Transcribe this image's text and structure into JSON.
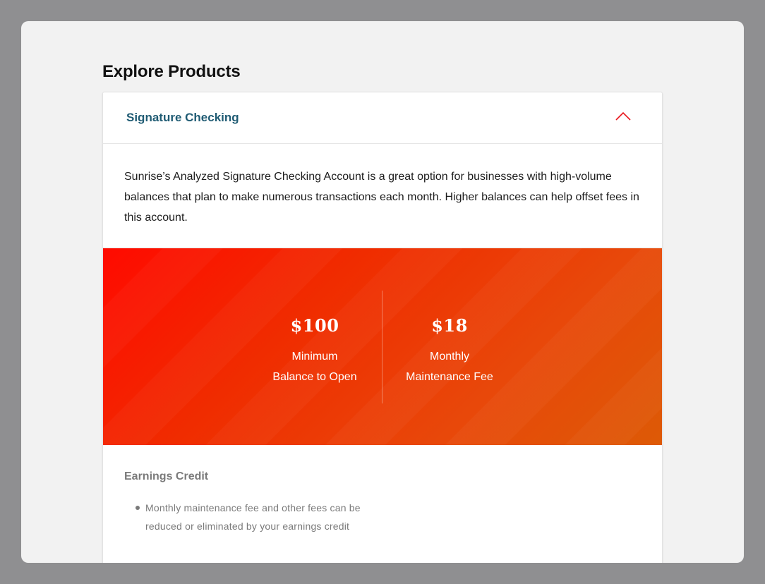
{
  "section": {
    "title": "Explore Products"
  },
  "product": {
    "name": "Signature Checking",
    "expanded": true,
    "description": "Sunrise’s Analyzed Signature Checking Account is a great option for businesses with high-volume balances that plan to make numerous transactions each month. Higher balances can help offset fees in this account."
  },
  "stats": [
    {
      "value": "$100",
      "label_line1": "Minimum",
      "label_line2": "Balance to Open"
    },
    {
      "value": "$18",
      "label_line1": "Monthly",
      "label_line2": "Maintenance Fee"
    }
  ],
  "features": {
    "title": "Earnings Credit",
    "items": [
      "Monthly maintenance fee and other fees can be reduced or eliminated by your earnings credit"
    ]
  },
  "colors": {
    "accent": "#e8151b",
    "header_text": "#1f5b73",
    "banner_start": "#ff0a00",
    "banner_end": "#dd5a06"
  },
  "icons": {
    "toggle": "chevron-up-icon"
  }
}
